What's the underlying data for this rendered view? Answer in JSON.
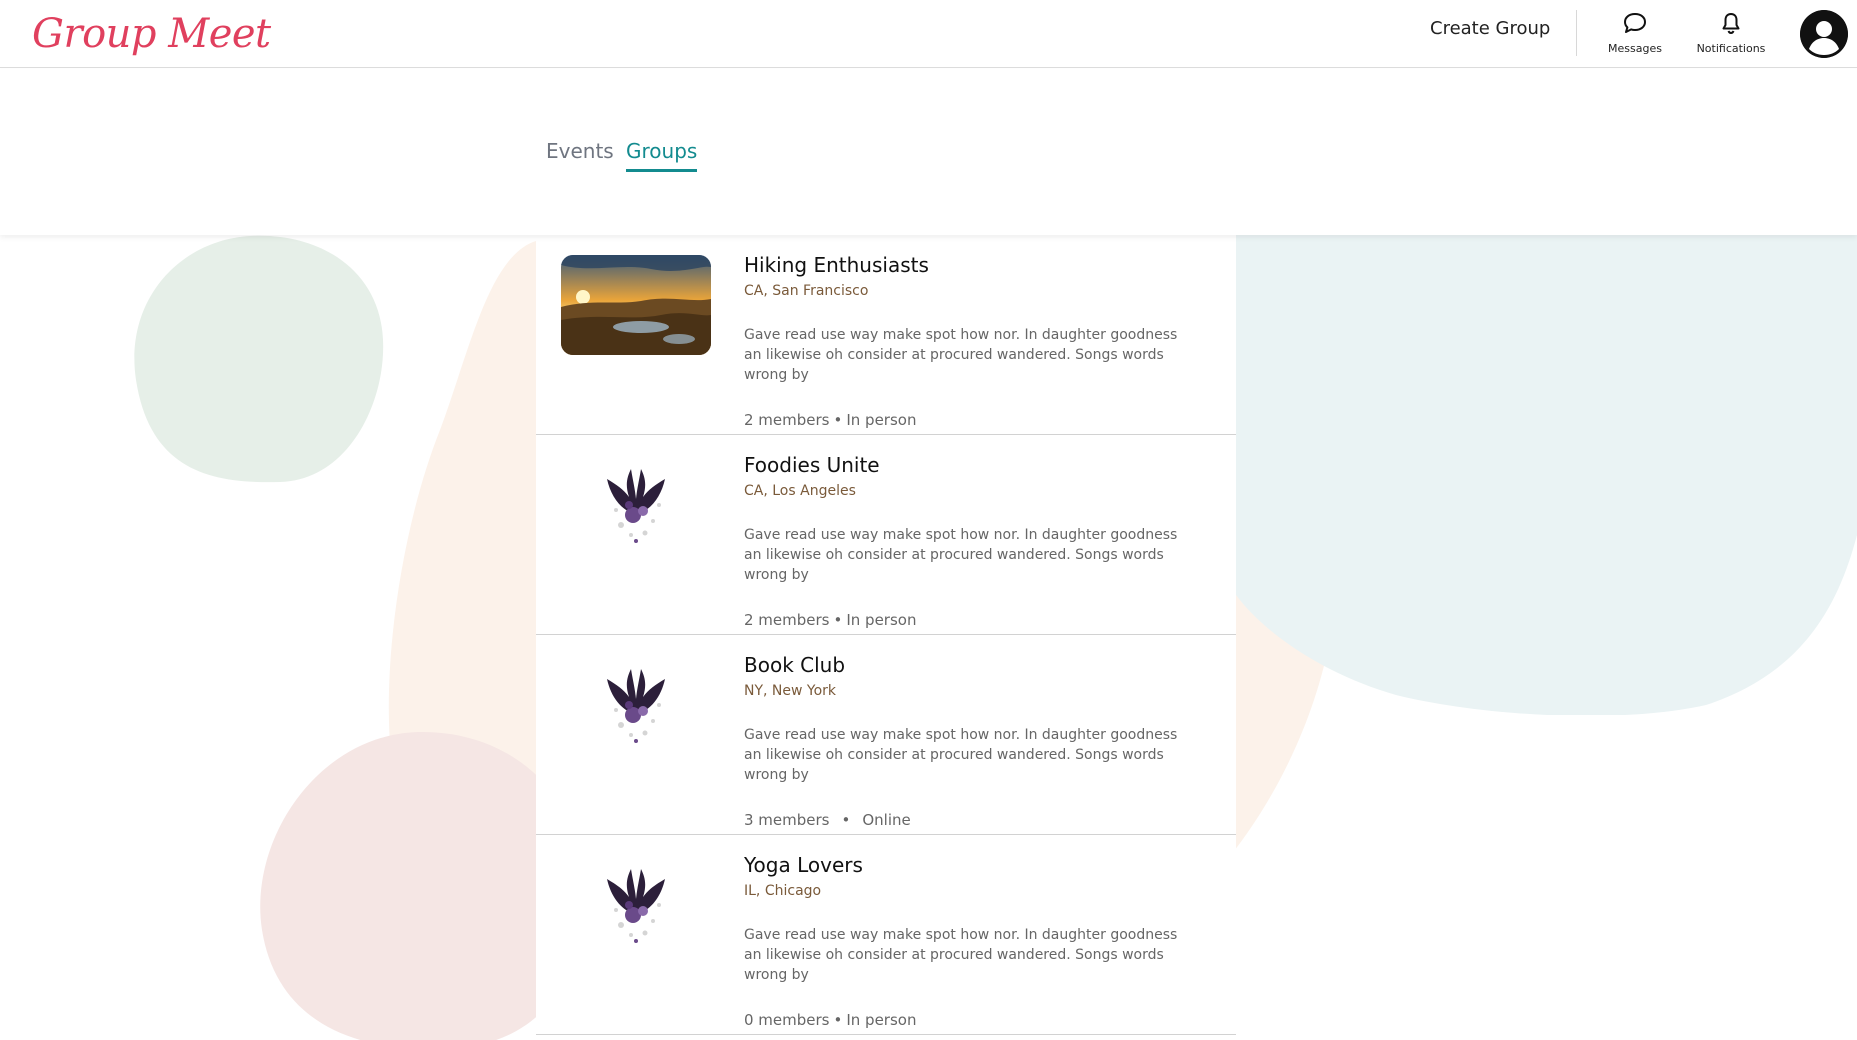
{
  "header": {
    "logo": "Group Meet",
    "create_group": "Create Group",
    "messages_label": "Messages",
    "notifications_label": "Notifications",
    "brand_color": "#e0405e"
  },
  "tabs": [
    {
      "label": "Events",
      "active": false
    },
    {
      "label": "Groups",
      "active": true
    }
  ],
  "accent_color": "#138b8f",
  "groups": [
    {
      "name": "Hiking Enthusiasts",
      "location": "CA, San Francisco",
      "description": "Gave read use way make spot how nor. In daughter goodness an likewise oh consider at procured wandered. Songs words wrong by",
      "members": "2 members",
      "mode": "In person",
      "image": "sunset-mountain-photo"
    },
    {
      "name": "Foodies Unite",
      "location": "CA, Los Angeles",
      "description": "Gave read use way make spot how nor. In daughter goodness an likewise oh consider at procured wandered. Songs words wrong by",
      "members": "2 members",
      "mode": "In person",
      "image": "purple-winged-emblem"
    },
    {
      "name": "Book Club",
      "location": "NY, New York",
      "description": "Gave read use way make spot how nor. In daughter goodness an likewise oh consider at procured wandered. Songs words wrong by",
      "members": "3 members",
      "mode": "Online",
      "image": "purple-winged-emblem"
    },
    {
      "name": "Yoga Lovers",
      "location": "IL, Chicago",
      "description": "Gave read use way make spot how nor. In daughter goodness an likewise oh consider at procured wandered. Songs words wrong by",
      "members": "0 members",
      "mode": "In person",
      "image": "purple-winged-emblem"
    }
  ]
}
